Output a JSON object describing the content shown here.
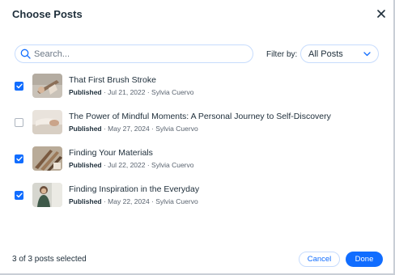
{
  "dialog": {
    "title": "Choose Posts",
    "close_icon": "close-icon"
  },
  "search": {
    "placeholder": "Search...",
    "value": "",
    "icon": "search-icon"
  },
  "filter": {
    "label": "Filter by:",
    "selected": "All Posts",
    "icon": "chevron-down-icon"
  },
  "posts": [
    {
      "title": "That First Brush Stroke",
      "status": "Published",
      "date": " · Jul 21, 2022 · Sylvia Cuervo",
      "checked": true
    },
    {
      "title": "The Power of Mindful Moments: A Personal Journey to Self-Discovery",
      "status": "Published",
      "date": " · May 27, 2024 · Sylvia Cuervo",
      "checked": false
    },
    {
      "title": "Finding Your Materials",
      "status": "Published",
      "date": " · Jul 22, 2022 · Sylvia Cuervo",
      "checked": true
    },
    {
      "title": "Finding Inspiration in the Everyday",
      "status": "Published",
      "date": " · May 22, 2024 · Sylvia Cuervo",
      "checked": true
    }
  ],
  "footer": {
    "selection_count": "3 of 3 posts selected",
    "cancel_label": "Cancel",
    "done_label": "Done"
  },
  "colors": {
    "accent": "#116dff",
    "text": "#20303c",
    "border": "#c7dcfd"
  }
}
